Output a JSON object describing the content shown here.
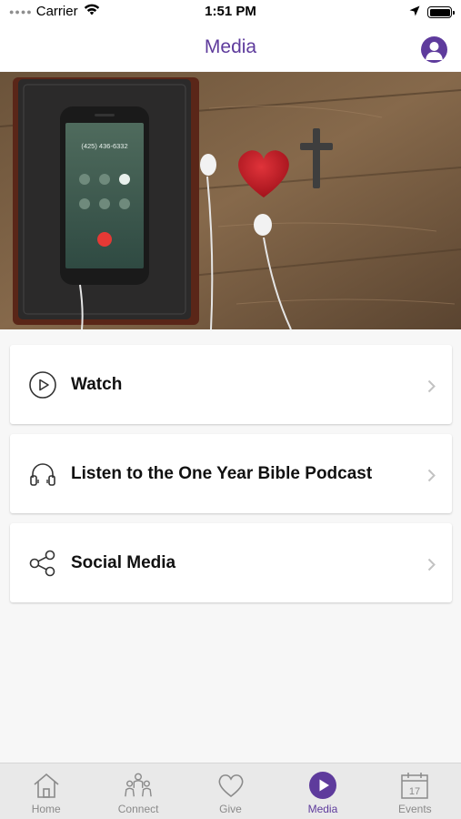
{
  "status_bar": {
    "carrier": "Carrier",
    "time": "1:51 PM"
  },
  "nav": {
    "title": "Media"
  },
  "menu": {
    "items": [
      {
        "label": "Watch",
        "icon": "play-circle-icon"
      },
      {
        "label": "Listen to the One Year Bible Podcast",
        "icon": "headphones-icon"
      },
      {
        "label": "Social Media",
        "icon": "share-icon"
      }
    ]
  },
  "tabs": [
    {
      "label": "Home",
      "icon": "home-icon",
      "active": false
    },
    {
      "label": "Connect",
      "icon": "people-icon",
      "active": false
    },
    {
      "label": "Give",
      "icon": "heart-icon",
      "active": false
    },
    {
      "label": "Media",
      "icon": "play-icon",
      "active": true
    },
    {
      "label": "Events",
      "icon": "calendar-icon",
      "active": false,
      "calendar_day": "17"
    }
  ],
  "colors": {
    "accent": "#5e3b9c",
    "inactive": "#8a8a8a",
    "background": "#f7f7f7"
  }
}
